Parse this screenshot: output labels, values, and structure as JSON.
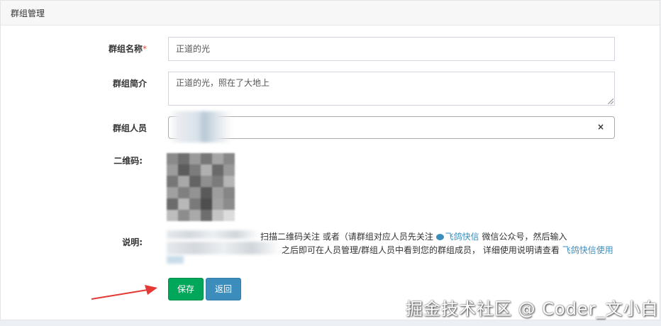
{
  "panel": {
    "title": "群组管理"
  },
  "form": {
    "name": {
      "label": "群组名称",
      "required_mark": "*",
      "value": "正道的光"
    },
    "intro": {
      "label": "群组简介",
      "value": "正道的光，照在了大地上"
    },
    "members": {
      "label": "群组人员",
      "clear_symbol": "×"
    },
    "qrcode": {
      "label": "二维码:"
    },
    "note": {
      "label": "说明:",
      "line1_text": "扫描二维码关注 或者（请群组对应人员先关注",
      "line1_link": "飞鸽快信",
      "line1_tail": "微信公众号，然后输入",
      "line2_text": "之后即可在人员管理/群组人员中看到您的群组成员， 详细使用说明请查看",
      "line2_link": "飞鸽快信使用"
    }
  },
  "buttons": {
    "save": "保存",
    "back": "返回"
  },
  "watermark": "掘金技术社区 @ Coder_文小白",
  "colors": {
    "save": "#00a65a",
    "back": "#3c8dbc",
    "link": "#3c8dbc",
    "required": "#dd4b39",
    "arrow": "#e53935"
  },
  "icons": {
    "link_icon": "wechat-icon"
  }
}
